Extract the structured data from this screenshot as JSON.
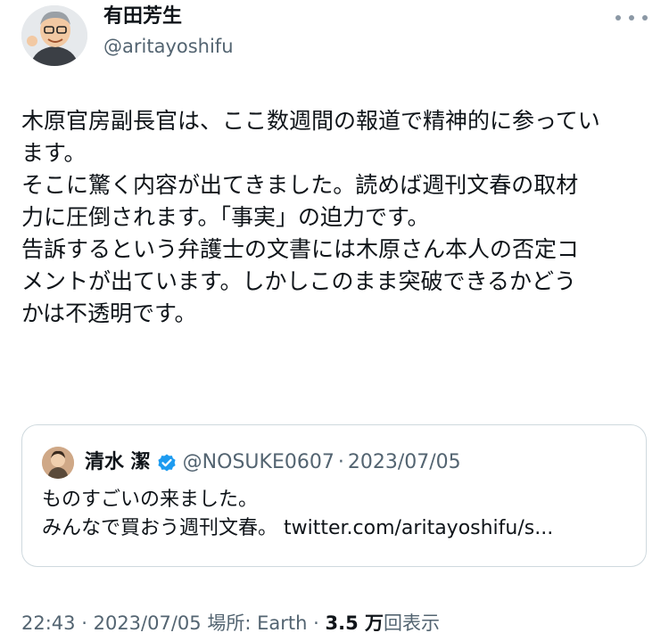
{
  "author": {
    "name": "有田芳生",
    "handle": "@aritayoshifu"
  },
  "tweet": {
    "lines": [
      "木原官房副長官は、ここ数週間の報道で精神的に参ってい",
      "ます。",
      "そこに驚く内容が出てきました。読めば週刊文春の取材",
      "力に圧倒されます。「事実」の迫力です。",
      "告訴するという弁護士の文書には木原さん本人の否定コ",
      "メントが出ています。しかしこのまま突破できるかどう",
      "かは不透明です。"
    ]
  },
  "quote": {
    "name": "清水 潔",
    "handle": "@NOSUKE0607",
    "separator": "·",
    "date": "2023/07/05",
    "lines": [
      "ものすごいの来ました。",
      "みんなで買おう週刊文春。 twitter.com/aritayoshifu/s..."
    ]
  },
  "meta": {
    "time": "22:43",
    "sep1": "·",
    "date": "2023/07/05",
    "location_label": "場所:",
    "location": "Earth",
    "sep2": "·",
    "views_count": "3.5 万",
    "views_label": "回表示"
  },
  "icons": {
    "more": "more-horizontal-icon",
    "verified": "verified-badge-icon",
    "verified_color": "#1d9bf0"
  }
}
